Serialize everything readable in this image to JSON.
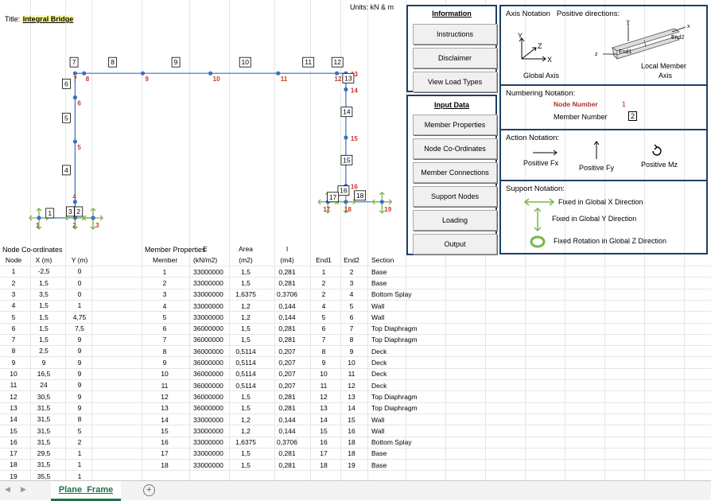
{
  "units": "Units: kN & m",
  "title_label": "Title:",
  "title_value": "Integral Bridge",
  "info_panel": {
    "title": "Information",
    "buttons": [
      "Instructions",
      "Disclaimer",
      "View Load Types"
    ]
  },
  "input_panel": {
    "title": "Input Data",
    "buttons": [
      "Member Properties",
      "Node Co-Ordinates",
      "Member Connections",
      "Support Nodes",
      "Loading",
      "Output"
    ]
  },
  "axis_notation": {
    "heading": "Axis Notation",
    "heading2": "Positive directions:",
    "global_label": "Global Axis",
    "local_label_1": "Local Member",
    "local_label_2": "Axis",
    "end2": "End2",
    "end1": "End1"
  },
  "numbering_notation": {
    "heading": "Numbering Notation:",
    "node_label": "Node Number",
    "node_num": "1",
    "member_label": "Member Number",
    "member_num": "2"
  },
  "action_notation": {
    "heading": "Action Notation:",
    "fx": "Positive Fx",
    "fy": "Positive  Fy",
    "mz": "Positive Mz"
  },
  "support_notation": {
    "heading": "Support Notation:",
    "x": "Fixed in Global X Direction",
    "y": "Fixed in Global Y Direction",
    "z": "Fixed Rotation in Global Z Direction"
  },
  "node_table": {
    "title": "Node Co-ordinates",
    "headers": [
      "Node",
      "X (m)",
      "Y (m)"
    ],
    "rows": [
      [
        "1",
        "-2,5",
        "0"
      ],
      [
        "2",
        "1,5",
        "0"
      ],
      [
        "3",
        "3,5",
        "0"
      ],
      [
        "4",
        "1,5",
        "1"
      ],
      [
        "5",
        "1,5",
        "4,75"
      ],
      [
        "6",
        "1,5",
        "7,5"
      ],
      [
        "7",
        "1,5",
        "9"
      ],
      [
        "8",
        "2,5",
        "9"
      ],
      [
        "9",
        "9",
        "9"
      ],
      [
        "10",
        "16,5",
        "9"
      ],
      [
        "11",
        "24",
        "9"
      ],
      [
        "12",
        "30,5",
        "9"
      ],
      [
        "13",
        "31,5",
        "9"
      ],
      [
        "14",
        "31,5",
        "8"
      ],
      [
        "15",
        "31,5",
        "5"
      ],
      [
        "16",
        "31,5",
        "2"
      ],
      [
        "17",
        "29,5",
        "1"
      ],
      [
        "18",
        "31,5",
        "1"
      ],
      [
        "19",
        "35,5",
        "1"
      ]
    ]
  },
  "member_table": {
    "title": "Member Properties",
    "headers_top": [
      "",
      "E",
      "Area",
      "I",
      "",
      "",
      ""
    ],
    "headers": [
      "Member",
      "(kN/m2)",
      "(m2)",
      "(m4)",
      "End1",
      "End2",
      "Section"
    ],
    "rows": [
      [
        "1",
        "33000000",
        "1,5",
        "0,281",
        "1",
        "2",
        "Base"
      ],
      [
        "2",
        "33000000",
        "1,5",
        "0,281",
        "2",
        "3",
        "Base"
      ],
      [
        "3",
        "33000000",
        "1,6375",
        "0,3706",
        "2",
        "4",
        "Bottom Splay"
      ],
      [
        "4",
        "33000000",
        "1,2",
        "0,144",
        "4",
        "5",
        "Wall"
      ],
      [
        "5",
        "33000000",
        "1,2",
        "0,144",
        "5",
        "6",
        "Wall"
      ],
      [
        "6",
        "36000000",
        "1,5",
        "0,281",
        "6",
        "7",
        "Top Diaphragm"
      ],
      [
        "7",
        "36000000",
        "1,5",
        "0,281",
        "7",
        "8",
        "Top Diaphragm"
      ],
      [
        "8",
        "36000000",
        "0,5114",
        "0,207",
        "8",
        "9",
        "Deck"
      ],
      [
        "9",
        "36000000",
        "0,5114",
        "0,207",
        "9",
        "10",
        "Deck"
      ],
      [
        "10",
        "36000000",
        "0,5114",
        "0,207",
        "10",
        "11",
        "Deck"
      ],
      [
        "11",
        "36000000",
        "0,5114",
        "0,207",
        "11",
        "12",
        "Deck"
      ],
      [
        "12",
        "36000000",
        "1,5",
        "0,281",
        "12",
        "13",
        "Top Diaphragm"
      ],
      [
        "13",
        "36000000",
        "1,5",
        "0,281",
        "13",
        "14",
        "Top Diaphragm"
      ],
      [
        "14",
        "33000000",
        "1,2",
        "0,144",
        "14",
        "15",
        "Wall"
      ],
      [
        "15",
        "33000000",
        "1,2",
        "0,144",
        "15",
        "16",
        "Wall"
      ],
      [
        "16",
        "33000000",
        "1,6375",
        "0,3706",
        "16",
        "18",
        "Bottom Splay"
      ],
      [
        "17",
        "33000000",
        "1,5",
        "0,281",
        "17",
        "18",
        "Base"
      ],
      [
        "18",
        "33000000",
        "1,5",
        "0,281",
        "18",
        "19",
        "Base"
      ]
    ]
  },
  "frame": {
    "node_labels": [
      "1",
      "2",
      "3",
      "4",
      "5",
      "6",
      "7",
      "8",
      "9",
      "10",
      "11",
      "12",
      "13",
      "14",
      "15",
      "16",
      "17",
      "18",
      "19"
    ],
    "member_labels": [
      "1",
      "2",
      "3",
      "4",
      "5",
      "6",
      "7",
      "8",
      "9",
      "10",
      "11",
      "12",
      "13",
      "14",
      "15",
      "16",
      "17",
      "18"
    ]
  },
  "sheet_tab": "Plane_Frame",
  "add_sheet": "+"
}
